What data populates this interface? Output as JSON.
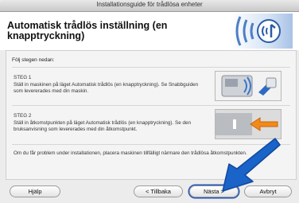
{
  "window": {
    "title": "Installationsguide för trådlösa enheter"
  },
  "header": {
    "title": "Automatisk trådlös inställning (en knapptryckning)"
  },
  "content": {
    "intro": "Följ stegen nedan:",
    "step1": {
      "label": "STEG 1",
      "text": "Ställ in maskinen på läget Automatisk trådlös (en knapptryckning). Se Snabbguiden som levererades med din maskin."
    },
    "step2": {
      "label": "STEG 2",
      "text": "Ställ in åtkomstpunkten på läget Automatisk trådlös (en knapptryckning). Se den bruksanvisning som levererades med din åtkomstpunkt."
    },
    "note": "Om du får problem under installationen, placera maskinen tillfälligt närmare den trådlösa åtkomstpunkten."
  },
  "buttons": {
    "help": "Hjälp",
    "back": "< Tillbaka",
    "next": "Nästa >",
    "cancel": "Avbryt"
  },
  "icons": {
    "logo": "wireless-signal-icon",
    "step1_image": "printer-wifi-icon",
    "step2_image": "access-point-button-icon",
    "pointer": "blue-arrow-icon"
  },
  "colors": {
    "accent": "#1f57b8",
    "arrow": "#1a63c8"
  }
}
